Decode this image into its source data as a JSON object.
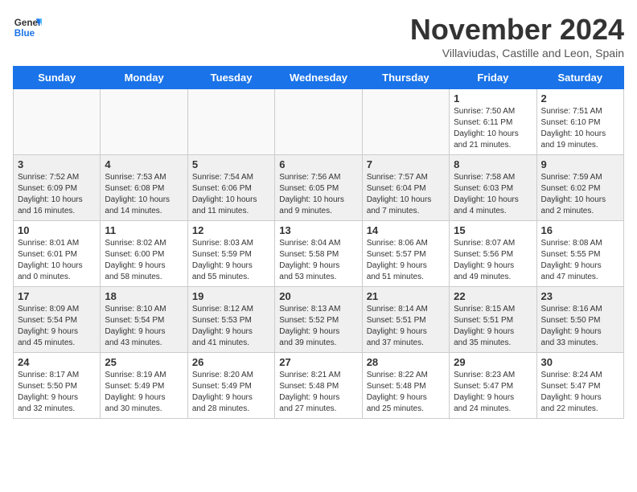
{
  "header": {
    "logo_line1": "General",
    "logo_line2": "Blue",
    "month": "November 2024",
    "location": "Villaviudas, Castille and Leon, Spain"
  },
  "weekdays": [
    "Sunday",
    "Monday",
    "Tuesday",
    "Wednesday",
    "Thursday",
    "Friday",
    "Saturday"
  ],
  "rows": [
    [
      {
        "day": "",
        "info": "",
        "empty": true
      },
      {
        "day": "",
        "info": "",
        "empty": true
      },
      {
        "day": "",
        "info": "",
        "empty": true
      },
      {
        "day": "",
        "info": "",
        "empty": true
      },
      {
        "day": "",
        "info": "",
        "empty": true
      },
      {
        "day": "1",
        "info": "Sunrise: 7:50 AM\nSunset: 6:11 PM\nDaylight: 10 hours\nand 21 minutes."
      },
      {
        "day": "2",
        "info": "Sunrise: 7:51 AM\nSunset: 6:10 PM\nDaylight: 10 hours\nand 19 minutes."
      }
    ],
    [
      {
        "day": "3",
        "info": "Sunrise: 7:52 AM\nSunset: 6:09 PM\nDaylight: 10 hours\nand 16 minutes.",
        "shaded": true
      },
      {
        "day": "4",
        "info": "Sunrise: 7:53 AM\nSunset: 6:08 PM\nDaylight: 10 hours\nand 14 minutes.",
        "shaded": true
      },
      {
        "day": "5",
        "info": "Sunrise: 7:54 AM\nSunset: 6:06 PM\nDaylight: 10 hours\nand 11 minutes.",
        "shaded": true
      },
      {
        "day": "6",
        "info": "Sunrise: 7:56 AM\nSunset: 6:05 PM\nDaylight: 10 hours\nand 9 minutes.",
        "shaded": true
      },
      {
        "day": "7",
        "info": "Sunrise: 7:57 AM\nSunset: 6:04 PM\nDaylight: 10 hours\nand 7 minutes.",
        "shaded": true
      },
      {
        "day": "8",
        "info": "Sunrise: 7:58 AM\nSunset: 6:03 PM\nDaylight: 10 hours\nand 4 minutes.",
        "shaded": true
      },
      {
        "day": "9",
        "info": "Sunrise: 7:59 AM\nSunset: 6:02 PM\nDaylight: 10 hours\nand 2 minutes.",
        "shaded": true
      }
    ],
    [
      {
        "day": "10",
        "info": "Sunrise: 8:01 AM\nSunset: 6:01 PM\nDaylight: 10 hours\nand 0 minutes."
      },
      {
        "day": "11",
        "info": "Sunrise: 8:02 AM\nSunset: 6:00 PM\nDaylight: 9 hours\nand 58 minutes."
      },
      {
        "day": "12",
        "info": "Sunrise: 8:03 AM\nSunset: 5:59 PM\nDaylight: 9 hours\nand 55 minutes."
      },
      {
        "day": "13",
        "info": "Sunrise: 8:04 AM\nSunset: 5:58 PM\nDaylight: 9 hours\nand 53 minutes."
      },
      {
        "day": "14",
        "info": "Sunrise: 8:06 AM\nSunset: 5:57 PM\nDaylight: 9 hours\nand 51 minutes."
      },
      {
        "day": "15",
        "info": "Sunrise: 8:07 AM\nSunset: 5:56 PM\nDaylight: 9 hours\nand 49 minutes."
      },
      {
        "day": "16",
        "info": "Sunrise: 8:08 AM\nSunset: 5:55 PM\nDaylight: 9 hours\nand 47 minutes."
      }
    ],
    [
      {
        "day": "17",
        "info": "Sunrise: 8:09 AM\nSunset: 5:54 PM\nDaylight: 9 hours\nand 45 minutes.",
        "shaded": true
      },
      {
        "day": "18",
        "info": "Sunrise: 8:10 AM\nSunset: 5:54 PM\nDaylight: 9 hours\nand 43 minutes.",
        "shaded": true
      },
      {
        "day": "19",
        "info": "Sunrise: 8:12 AM\nSunset: 5:53 PM\nDaylight: 9 hours\nand 41 minutes.",
        "shaded": true
      },
      {
        "day": "20",
        "info": "Sunrise: 8:13 AM\nSunset: 5:52 PM\nDaylight: 9 hours\nand 39 minutes.",
        "shaded": true
      },
      {
        "day": "21",
        "info": "Sunrise: 8:14 AM\nSunset: 5:51 PM\nDaylight: 9 hours\nand 37 minutes.",
        "shaded": true
      },
      {
        "day": "22",
        "info": "Sunrise: 8:15 AM\nSunset: 5:51 PM\nDaylight: 9 hours\nand 35 minutes.",
        "shaded": true
      },
      {
        "day": "23",
        "info": "Sunrise: 8:16 AM\nSunset: 5:50 PM\nDaylight: 9 hours\nand 33 minutes.",
        "shaded": true
      }
    ],
    [
      {
        "day": "24",
        "info": "Sunrise: 8:17 AM\nSunset: 5:50 PM\nDaylight: 9 hours\nand 32 minutes."
      },
      {
        "day": "25",
        "info": "Sunrise: 8:19 AM\nSunset: 5:49 PM\nDaylight: 9 hours\nand 30 minutes."
      },
      {
        "day": "26",
        "info": "Sunrise: 8:20 AM\nSunset: 5:49 PM\nDaylight: 9 hours\nand 28 minutes."
      },
      {
        "day": "27",
        "info": "Sunrise: 8:21 AM\nSunset: 5:48 PM\nDaylight: 9 hours\nand 27 minutes."
      },
      {
        "day": "28",
        "info": "Sunrise: 8:22 AM\nSunset: 5:48 PM\nDaylight: 9 hours\nand 25 minutes."
      },
      {
        "day": "29",
        "info": "Sunrise: 8:23 AM\nSunset: 5:47 PM\nDaylight: 9 hours\nand 24 minutes."
      },
      {
        "day": "30",
        "info": "Sunrise: 8:24 AM\nSunset: 5:47 PM\nDaylight: 9 hours\nand 22 minutes."
      }
    ]
  ]
}
